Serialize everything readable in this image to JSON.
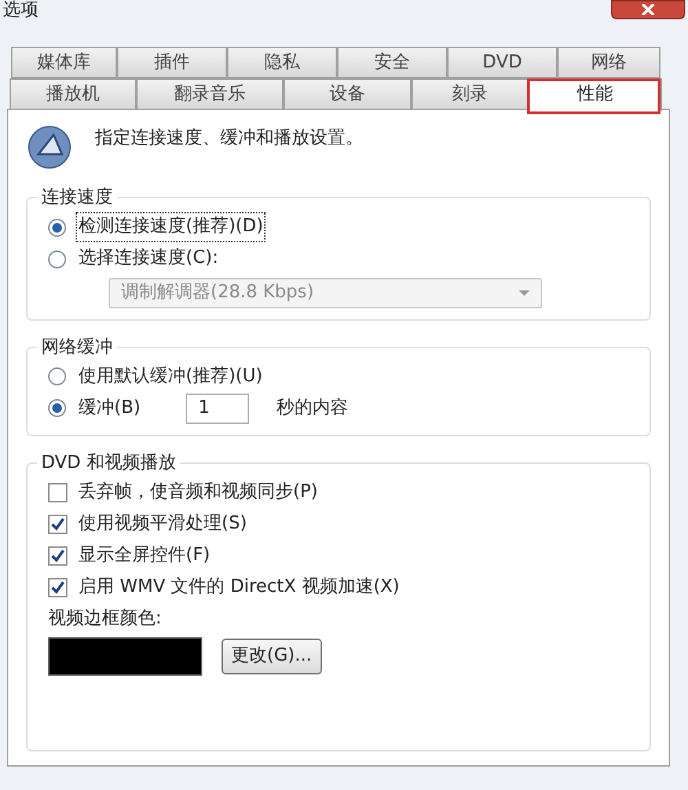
{
  "window": {
    "title": "选项"
  },
  "tabs": [
    [
      {
        "label": "媒体库",
        "selected": false
      },
      {
        "label": "插件",
        "selected": false
      },
      {
        "label": "隐私",
        "selected": false
      },
      {
        "label": "安全",
        "selected": false
      },
      {
        "label": "DVD",
        "selected": false
      },
      {
        "label": "网络",
        "selected": false
      }
    ],
    [
      {
        "label": "播放机",
        "selected": false
      },
      {
        "label": "翻录音乐",
        "selected": false
      },
      {
        "label": "设备",
        "selected": false
      },
      {
        "label": "刻录",
        "selected": false
      },
      {
        "label": "性能",
        "selected": true,
        "highlighted": true
      }
    ]
  ],
  "header": {
    "text": "指定连接速度、缓冲和播放设置。"
  },
  "groups": [
    {
      "title": "连接速度",
      "items": [
        {
          "kind": "radio",
          "label": "检测连接速度(推荐)(D)",
          "selected": true,
          "focused": true
        },
        {
          "kind": "radio",
          "label": "选择连接速度(C):",
          "selected": false
        },
        {
          "kind": "select",
          "value": "调制解调器(28.8 Kbps)",
          "disabled": true
        }
      ]
    },
    {
      "title": "网络缓冲",
      "items": [
        {
          "kind": "radio",
          "label": "使用默认缓冲(推荐)(U)",
          "selected": false
        },
        {
          "kind": "radio",
          "label": "缓冲(B)",
          "selected": true,
          "input": "1",
          "suffix": "秒的内容"
        }
      ]
    },
    {
      "title": "DVD 和视频播放",
      "items": [
        {
          "kind": "checkbox",
          "label": "丢弃帧，使音频和视频同步(P)",
          "checked": false
        },
        {
          "kind": "checkbox",
          "label": "使用视频平滑处理(S)",
          "checked": true
        },
        {
          "kind": "checkbox",
          "label": "显示全屏控件(F)",
          "checked": true
        },
        {
          "kind": "checkbox",
          "label": "启用 WMV 文件的 DirectX 视频加速(X)",
          "checked": true
        },
        {
          "kind": "label",
          "label": "视频边框颜色:"
        },
        {
          "kind": "color",
          "color": "#000000",
          "button": "更改(G)..."
        }
      ]
    }
  ]
}
